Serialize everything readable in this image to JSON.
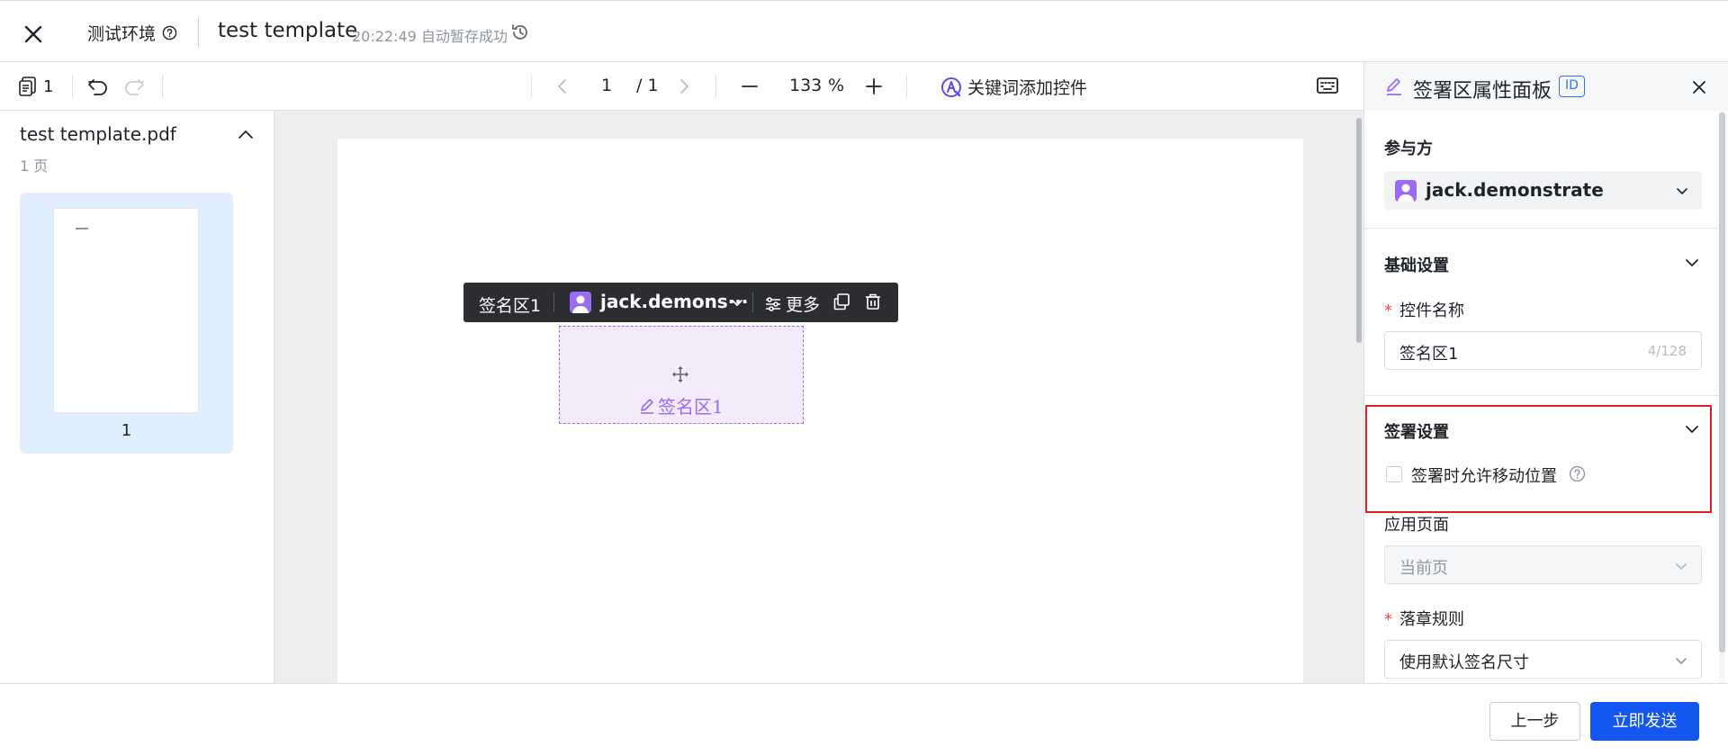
{
  "header": {
    "environment_label": "测试环境",
    "template_title": "test template",
    "autosave_status": "20:22:49 自动暂存成功"
  },
  "toolbar": {
    "page_count_badge": "1",
    "current_page": "1",
    "total_pages": "/ 1",
    "zoom_value": "133",
    "zoom_unit": "%",
    "keyword_add_label": "关键词添加控件"
  },
  "file_panel": {
    "file_name": "test template.pdf",
    "page_count_text": "1 页",
    "thumbnails": [
      {
        "page_label": "1"
      }
    ]
  },
  "canvas": {
    "control_bar": {
      "name": "签名区1",
      "assignee": "jack.demons···",
      "more_label": "更多"
    },
    "signature_box_label": "签名区1"
  },
  "property_panel": {
    "title": "签署区属性面板",
    "id_badge": "ID",
    "participant_section": {
      "label": "参与方",
      "selected": "jack.demonstrate"
    },
    "basic_settings": {
      "title": "基础设置",
      "control_name_label": "控件名称",
      "control_name_value": "签名区1",
      "control_name_count": "4/128"
    },
    "sign_settings": {
      "title": "签署设置",
      "allow_move_label": "签署时允许移动位置",
      "allow_move_checked": false
    },
    "apply_page": {
      "label": "应用页面",
      "value": "当前页"
    },
    "stamp_rule": {
      "label": "落章规则",
      "value": "使用默认签名尺寸"
    }
  },
  "footer": {
    "prev_label": "上一步",
    "send_label": "立即发送"
  },
  "colors": {
    "primary_blue": "#1456f0",
    "signature_purple": "#9b6bf3",
    "highlight_red": "#e02020",
    "thumb_selected_bg": "#e1eefd"
  }
}
